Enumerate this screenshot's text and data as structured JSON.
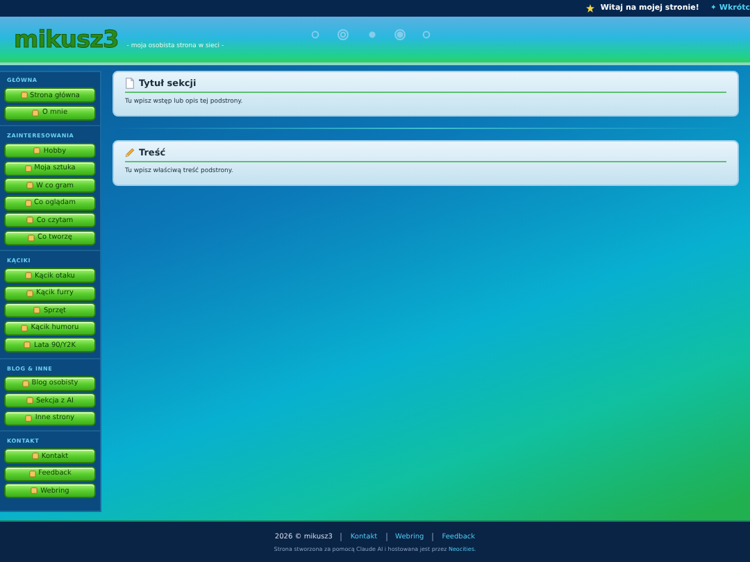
{
  "top_bar": {
    "greeting": "Witaj na mojej stronie!",
    "teaser": "✦ Wkrótc"
  },
  "header": {
    "logo": "mikusz3",
    "tagline": "- moja osobista strona w sieci -"
  },
  "sidebar": {
    "sections": [
      {
        "heading": "GŁÓWNA",
        "items": [
          {
            "label": "Strona główna"
          },
          {
            "label": "O mnie"
          }
        ]
      },
      {
        "heading": "ZAINTERESOWANIA",
        "items": [
          {
            "label": "Hobby"
          },
          {
            "label": "Moja sztuka"
          },
          {
            "label": "W co gram"
          },
          {
            "label": "Co oglądam"
          },
          {
            "label": "Co czytam"
          },
          {
            "label": "Co tworzę"
          }
        ]
      },
      {
        "heading": "KĄCIKI",
        "items": [
          {
            "label": "Kącik otaku"
          },
          {
            "label": "Kącik furry"
          },
          {
            "label": "Sprzęt"
          },
          {
            "label": "Kącik humoru"
          },
          {
            "label": "Lata 90/Y2K"
          }
        ]
      },
      {
        "heading": "BLOG & INNE",
        "items": [
          {
            "label": "Blog osobisty"
          },
          {
            "label": "Sekcja z AI"
          },
          {
            "label": "Inne strony"
          }
        ]
      },
      {
        "heading": "KONTAKT",
        "items": [
          {
            "label": "Kontakt"
          },
          {
            "label": "Feedback"
          },
          {
            "label": "Webring"
          }
        ]
      }
    ]
  },
  "panels": [
    {
      "kind": "document",
      "title": "Tytuł sekcji",
      "text": "Tu wpisz wstęp lub opis tej podstrony."
    },
    {
      "kind": "pencil",
      "title": "Treść",
      "text": "Tu wpisz właściwą treść podstrony."
    }
  ],
  "footer": {
    "copyright": "2026 © mikusz3",
    "links": [
      "Kontakt",
      "Webring",
      "Feedback"
    ],
    "credit": "Strona stworzona za pomocą Claude AI i hostowana jest przez ",
    "credit_link": "Neocities."
  }
}
